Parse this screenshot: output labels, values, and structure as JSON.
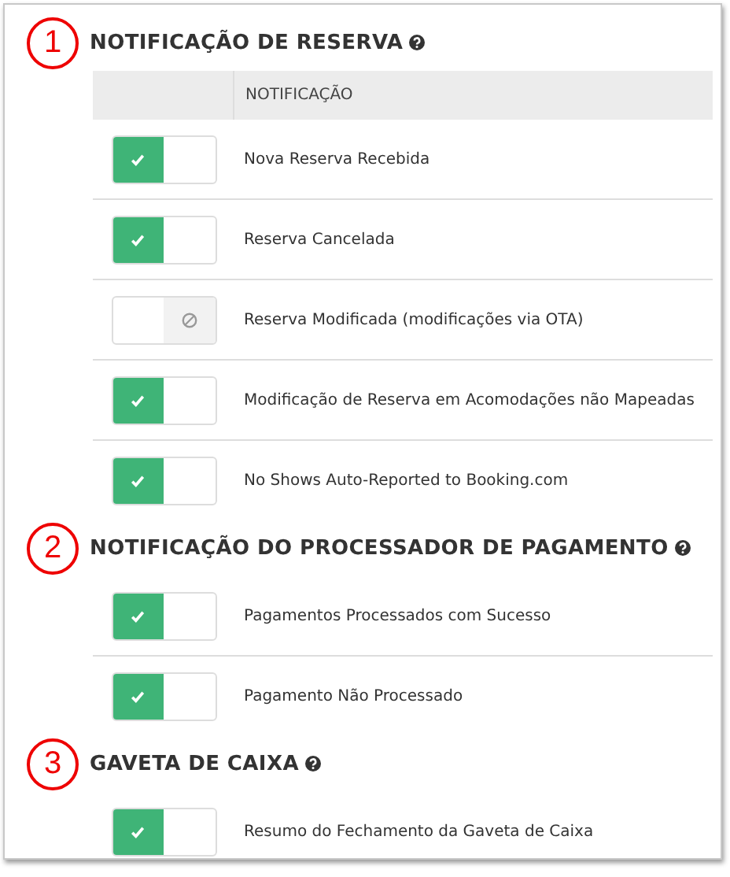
{
  "sections": [
    {
      "number": "1",
      "title": "NOTIFICAÇÃO DE RESERVA",
      "columns": [
        "NOTIFICAÇÃO"
      ],
      "rows": [
        {
          "label": "Nova Reserva Recebida",
          "on": true
        },
        {
          "label": "Reserva Cancelada",
          "on": true
        },
        {
          "label": "Reserva Modificada (modificações via OTA)",
          "on": false
        },
        {
          "label": "Modificação de Reserva em Acomodações não Mapeadas",
          "on": true
        },
        {
          "label": "No Shows Auto-Reported to Booking.com",
          "on": true
        }
      ]
    },
    {
      "number": "2",
      "title": "NOTIFICAÇÃO DO PROCESSADOR DE PAGAMENTO",
      "rows": [
        {
          "label": "Pagamentos Processados com Sucesso",
          "on": true
        },
        {
          "label": "Pagamento Não Processado",
          "on": true
        }
      ]
    },
    {
      "number": "3",
      "title": "GAVETA DE CAIXA",
      "rows": [
        {
          "label": "Resumo do Fechamento da Gaveta de Caixa",
          "on": true
        }
      ]
    }
  ]
}
